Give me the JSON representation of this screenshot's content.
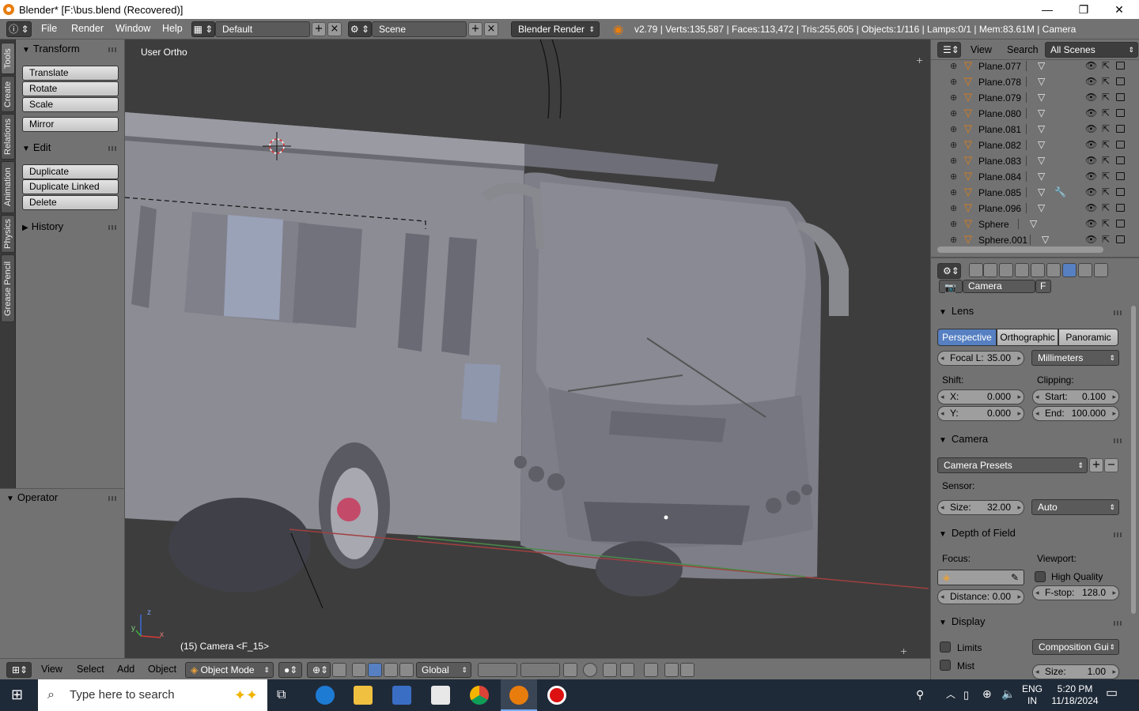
{
  "window": {
    "title": "Blender* [F:\\bus.blend (Recovered)]",
    "minimize": "—",
    "maximize": "❐",
    "close": "✕"
  },
  "topbar": {
    "menus": [
      "File",
      "Render",
      "Window",
      "Help"
    ],
    "layout": "Default",
    "scene": "Scene",
    "engine": "Blender Render",
    "stats": "v2.79 | Verts:135,587 | Faces:113,472 | Tris:255,605 | Objects:1/116 | Lamps:0/1 | Mem:83.61M | Camera"
  },
  "tool_tabs": [
    "Tools",
    "Create",
    "Relations",
    "Animation",
    "Physics",
    "Grease Pencil"
  ],
  "tool_panel": {
    "transform": {
      "title": "Transform",
      "buttons": [
        "Translate",
        "Rotate",
        "Scale"
      ],
      "mirror": "Mirror"
    },
    "edit": {
      "title": "Edit",
      "buttons": [
        "Duplicate",
        "Duplicate Linked",
        "Delete"
      ]
    },
    "history": {
      "title": "History"
    },
    "operator": {
      "title": "Operator"
    }
  },
  "viewport": {
    "view_label": "User Ortho",
    "object_label": "(15) Camera <F_15>",
    "axis_x": "x",
    "axis_y": "y",
    "axis_z": "z"
  },
  "bottombar": {
    "menus": [
      "View",
      "Select",
      "Add",
      "Object"
    ],
    "mode": "Object Mode",
    "orientation": "Global"
  },
  "outliner": {
    "menus": [
      "View",
      "Search"
    ],
    "scope": "All Scenes",
    "items": [
      "Plane.077",
      "Plane.078",
      "Plane.079",
      "Plane.080",
      "Plane.081",
      "Plane.082",
      "Plane.083",
      "Plane.084",
      "Plane.085",
      "Plane.096",
      "Sphere",
      "Sphere.001"
    ]
  },
  "properties": {
    "datablock": "Camera",
    "fake_user": "F",
    "lens": {
      "title": "Lens",
      "types": [
        "Perspective",
        "Orthographic",
        "Panoramic"
      ],
      "active_type": "Perspective",
      "focal_label": "Focal L:",
      "focal_value": "35.00",
      "unit": "Millimeters",
      "shift_label": "Shift:",
      "shift_x_label": "X:",
      "shift_x": "0.000",
      "shift_y_label": "Y:",
      "shift_y": "0.000",
      "clipping_label": "Clipping:",
      "clip_start_label": "Start:",
      "clip_start": "0.100",
      "clip_end_label": "End:",
      "clip_end": "100.000"
    },
    "camera": {
      "title": "Camera",
      "presets": "Camera Presets",
      "sensor_label": "Sensor:",
      "size_label": "Size:",
      "size_value": "32.00",
      "fit": "Auto"
    },
    "dof": {
      "title": "Depth of Field",
      "focus_label": "Focus:",
      "viewport_label": "Viewport:",
      "high_quality": "High Quality",
      "distance_label": "Distance:",
      "distance_value": "0.00",
      "fstop_label": "F-stop:",
      "fstop_value": "128.0"
    },
    "display": {
      "title": "Display",
      "limits": "Limits",
      "mist": "Mist",
      "composition": "Composition Gui",
      "size_label": "Size:",
      "size_value": "1.00"
    }
  },
  "taskbar": {
    "search_placeholder": "Type here to search",
    "lang1": "ENG",
    "lang2": "IN",
    "time": "5:20 PM",
    "date": "11/18/2024"
  },
  "colors": {
    "accent_blue": "#5680c2",
    "orange": "#e87d0d",
    "panel": "#727272",
    "viewport_bg": "#3d3d3d"
  }
}
